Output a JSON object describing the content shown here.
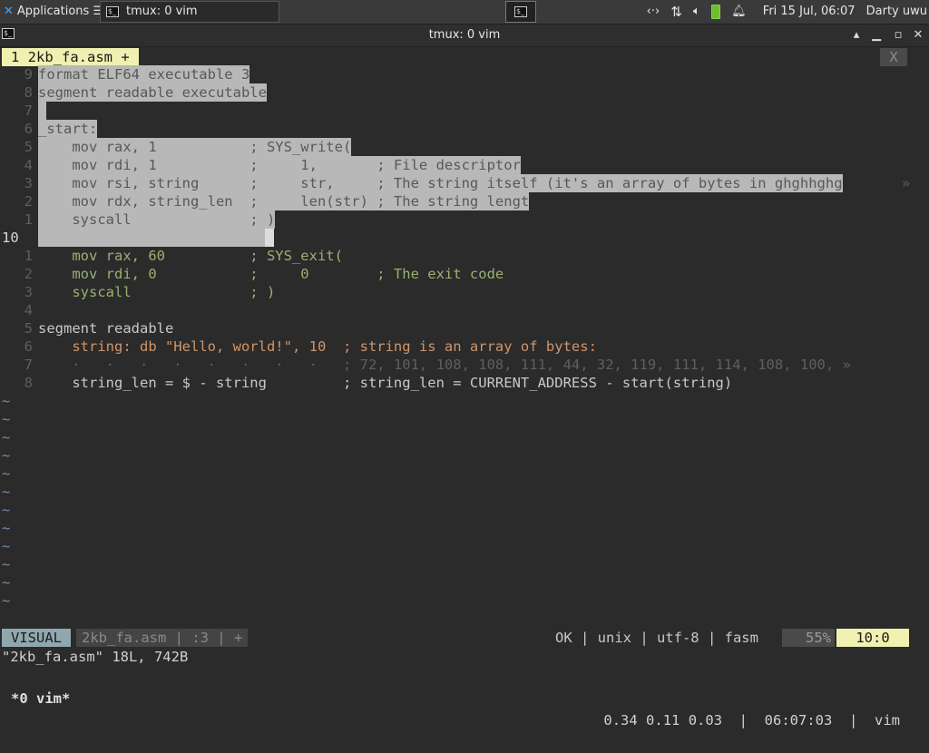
{
  "panel": {
    "apps_label": "Applications",
    "apps_suffix": "☰",
    "task_title": "tmux: 0 vim",
    "datetime": "Fri 15 Jul, 06:07",
    "user": "Darty uwu"
  },
  "window": {
    "title": "tmux: 0 vim",
    "min_label": "▁",
    "max_label": "▴",
    "restore_label": "▫",
    "close_label": "✕"
  },
  "tabline": {
    "tab_label": "1  2kb_fa.asm  +",
    "close_label": "X"
  },
  "code": {
    "lines": [
      {
        "num": "9",
        "text": "format ELF64 executable 3"
      },
      {
        "num": "8",
        "text": "segment readable executable"
      },
      {
        "num": "7",
        "text": " "
      },
      {
        "num": "6",
        "text": "_start:"
      },
      {
        "num": "5",
        "text": "    mov rax, 1           ; SYS_write("
      },
      {
        "num": "4",
        "text": "    mov rdi, 1           ;     1,       ; File descriptor"
      },
      {
        "num": "3",
        "text": "    mov rsi, string      ;     str,     ; The string itself (it's an array of bytes in ghghhghg"
      },
      {
        "num": "2",
        "text": "    mov rdx, string_len  ;     len(str) ; The string lengt"
      },
      {
        "num": "1",
        "text": "    syscall              ; )"
      },
      {
        "num": "10",
        "text": ""
      },
      {
        "num": "1",
        "text": "    mov rax, 60          ; SYS_exit("
      },
      {
        "num": "2",
        "text": "    mov rdi, 0           ;     0        ; The exit code"
      },
      {
        "num": "3",
        "text": "    syscall              ; )"
      },
      {
        "num": "4",
        "text": ""
      },
      {
        "num": "5",
        "text": "segment readable"
      },
      {
        "num": "6",
        "text": "    string: db \"Hello, world!\", 10  ; string is an array of bytes:"
      },
      {
        "num": "7",
        "text": "    ·   ·   ·   ·   ·   ·   ·   ·   ; 72, 101, 108, 108, 111, 44, 32, 119, 111, 114, 108, 100, »"
      },
      {
        "num": "8",
        "text": "    string_len = $ - string         ; string_len = CURRENT_ADDRESS - start(string)"
      }
    ],
    "tilde": "~",
    "tilde_count": 12,
    "wrap_marker": "»"
  },
  "statusline": {
    "mode": "VISUAL",
    "file": "2kb_fa.asm  |  :3  |  +",
    "right": "OK  |  unix  |  utf-8  |  fasm",
    "percent": "55%",
    "position": "10:0"
  },
  "message": "\"2kb_fa.asm\" 18L, 742B",
  "tmux": {
    "left": "*0 vim*",
    "right": "0.34 0.11 0.03  |  06:07:03  |  vim"
  },
  "colors": {
    "selection": "#b8b8b8",
    "tab_active": "#f0f0b0",
    "mode_bg": "#8fa8b0"
  }
}
